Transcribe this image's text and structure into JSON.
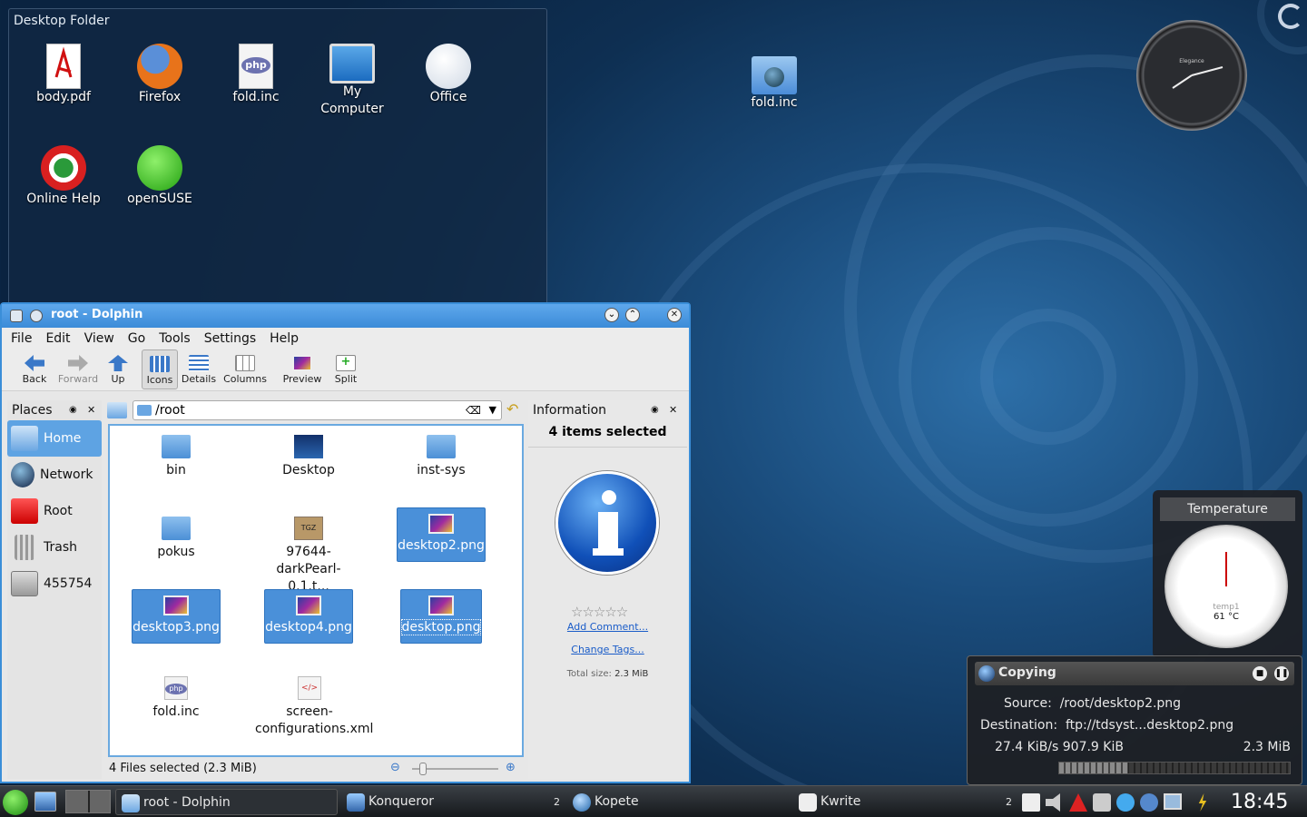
{
  "desktop_folder": {
    "title": "Desktop Folder",
    "icons": [
      "body.pdf",
      "Firefox",
      "fold.inc",
      "My\nComputer",
      "Office",
      "Online Help",
      "openSUSE"
    ]
  },
  "desktop_icon": {
    "label": "fold.inc"
  },
  "clock": {
    "brand": "Elegance"
  },
  "dolphin": {
    "title": "root - Dolphin",
    "menu": [
      "File",
      "Edit",
      "View",
      "Go",
      "Tools",
      "Settings",
      "Help"
    ],
    "toolbar": [
      "Back",
      "Forward",
      "Up",
      "Icons",
      "Details",
      "Columns",
      "Preview",
      "Split"
    ],
    "places_header": "Places",
    "places": [
      "Home",
      "Network",
      "Root",
      "Trash",
      "455754"
    ],
    "location": "/root",
    "files": [
      "bin",
      "Desktop",
      "inst-sys",
      "pokus",
      "97644-\ndarkPearl-0.1.t...",
      "desktop2.png",
      "desktop3.png",
      "desktop4.png",
      "desktop.png",
      "fold.inc",
      "screen-\nconfigurations.xml"
    ],
    "info_header": "Information",
    "info_title": "4 items selected",
    "add_comment": "Add Comment...",
    "change_tags": "Change Tags...",
    "total_size": "Total size:",
    "total_size_value": "2.3 MiB",
    "status": "4 Files selected (2.3 MiB)"
  },
  "temperature": {
    "title": "Temperature",
    "sensor": "temp1",
    "value": "61",
    "unit": "°C"
  },
  "copying": {
    "title": "Copying",
    "source_label": "Source:",
    "source": "/root/desktop2.png",
    "dest_label": "Destination:",
    "dest": "ftp://tdsyst...desktop2.png",
    "speed": "27.4 KiB/s 907.9 KiB",
    "total": "2.3 MiB",
    "progress": 0.3
  },
  "taskbar": {
    "tasks": [
      "root - Dolphin",
      "Konqueror",
      "Kopete",
      "Kwrite"
    ],
    "counts": [
      "2",
      "2"
    ],
    "time": "18:45"
  }
}
